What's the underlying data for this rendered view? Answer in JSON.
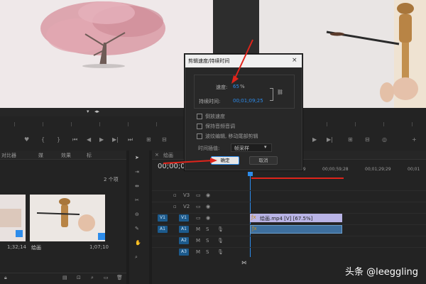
{
  "source_monitor": {
    "label": "cherry-tree-painting"
  },
  "program_monitor": {
    "label": "brush-video"
  },
  "source_controls": {
    "timecode": "00;00;00;00"
  },
  "dialog": {
    "title": "剪辑速度/持续时间",
    "speed_label": "速度:",
    "speed_value": "65",
    "speed_unit": "%",
    "duration_label": "持续时间:",
    "duration_value": "00;01;09;25",
    "checkbox_reverse": "倒放速度",
    "checkbox_pitch": "保持音频音调",
    "checkbox_ripple": "波纹编辑, 移动尾部剪辑",
    "interp_label": "时间插值:",
    "interp_value": "帧采样",
    "ok": "确定",
    "cancel": "取消"
  },
  "project": {
    "tabs": [
      "对比器",
      "媒",
      "效果",
      "标"
    ],
    "item_count": "2 个项",
    "clips": [
      {
        "name": "",
        "duration": "1;32;14"
      },
      {
        "name": "绘画",
        "duration": "1;07;10"
      }
    ]
  },
  "timeline": {
    "tab": "绘画",
    "timecode": "00;00;00",
    "ruler": [
      "00;00",
      "00;00;29;29",
      "00;00;59;28",
      "00;01;29;29",
      "00;01"
    ],
    "tracks": {
      "v3": "V3",
      "v2": "V2",
      "v1": "V1",
      "a1": "A1",
      "a2": "A2",
      "a3": "A3",
      "src_v1": "V1",
      "src_a1": "A1"
    },
    "video_clip_label": "绘画.mp4 [V] [67.5%]"
  },
  "watermark": "头条 @leeggling",
  "colors": {
    "accent_blue": "#2d8ceb",
    "red_arrow": "#e0241b",
    "track_blue": "#1c5a8c",
    "clip_violet": "#b9b4e6",
    "audio_clip": "#3e6f9e",
    "ok_button": "#e6e6e6"
  }
}
